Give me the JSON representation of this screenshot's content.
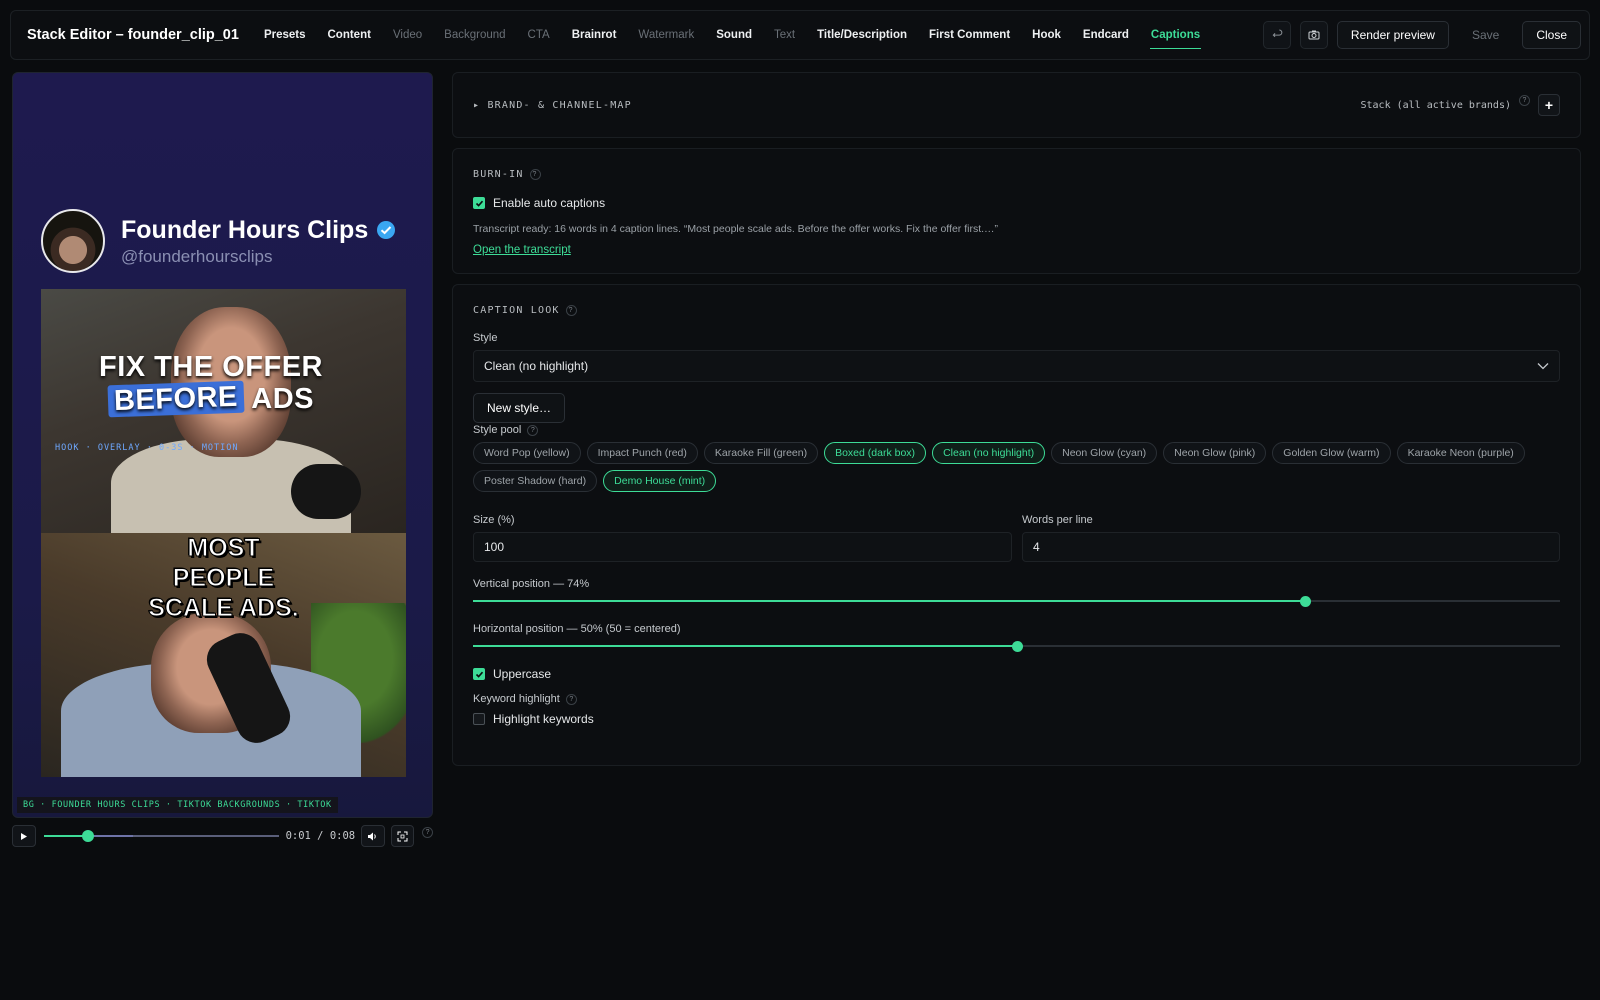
{
  "header": {
    "title": "Stack Editor – founder_clip_01",
    "tabs": [
      {
        "label": "Presets",
        "state": "normal"
      },
      {
        "label": "Content",
        "state": "normal"
      },
      {
        "label": "Video",
        "state": "dim"
      },
      {
        "label": "Background",
        "state": "dim"
      },
      {
        "label": "CTA",
        "state": "dim"
      },
      {
        "label": "Brainrot",
        "state": "normal"
      },
      {
        "label": "Watermark",
        "state": "dim"
      },
      {
        "label": "Sound",
        "state": "normal"
      },
      {
        "label": "Text",
        "state": "dim"
      },
      {
        "label": "Title/Description",
        "state": "normal"
      },
      {
        "label": "First Comment",
        "state": "normal"
      },
      {
        "label": "Hook",
        "state": "normal"
      },
      {
        "label": "Endcard",
        "state": "normal"
      },
      {
        "label": "Captions",
        "state": "active"
      }
    ],
    "render_label": "Render preview",
    "save_label": "Save",
    "close_label": "Close"
  },
  "preview": {
    "channel_name": "Founder Hours Clips",
    "channel_handle": "@founderhoursclips",
    "hook_line1": "FIX THE OFFER",
    "hook_highlight": "BEFORE",
    "hook_line2_rest": " ADS",
    "overlay_label": "HOOK · OVERLAY · 0-3S · MOTION",
    "caption_lines": [
      "MOST",
      "PEOPLE",
      "SCALE ADS."
    ],
    "bg_label": "BG · FOUNDER HOURS CLIPS · TIKTOK BACKGROUNDS · TIKTOK"
  },
  "player": {
    "time": "0:01  /  0:08",
    "progress": 0.19,
    "buffered": 0.38
  },
  "brand": {
    "label": "▸ BRAND- & CHANNEL-MAP",
    "stack_label": "Stack (all active brands)",
    "plus": "+"
  },
  "burnin": {
    "label": "BURN-IN",
    "enable_label": "Enable auto captions",
    "enabled": true,
    "transcript": "Transcript ready: 16 words in 4 caption lines. “Most people scale ads. Before the offer works. Fix the offer first.…”",
    "open_link": "Open the transcript"
  },
  "look": {
    "label": "CAPTION LOOK",
    "style_label": "Style",
    "style_value": "Clean (no highlight)",
    "new_style": "New style…",
    "pool_label": "Style pool",
    "pool": [
      {
        "label": "Word Pop (yellow)",
        "selected": false
      },
      {
        "label": "Impact Punch (red)",
        "selected": false
      },
      {
        "label": "Karaoke Fill (green)",
        "selected": false
      },
      {
        "label": "Boxed (dark box)",
        "selected": true
      },
      {
        "label": "Clean (no highlight)",
        "selected": true
      },
      {
        "label": "Neon Glow (cyan)",
        "selected": false
      },
      {
        "label": "Neon Glow (pink)",
        "selected": false
      },
      {
        "label": "Golden Glow (warm)",
        "selected": false
      },
      {
        "label": "Karaoke Neon (purple)",
        "selected": false
      },
      {
        "label": "Poster Shadow (hard)",
        "selected": false
      },
      {
        "label": "Demo House (mint)",
        "selected": true
      }
    ],
    "size_label": "Size (%)",
    "size_value": "100",
    "wpl_label": "Words per line",
    "wpl_value": "4",
    "vpos_label": "Vertical position — 74%",
    "vpos_value": 0.765,
    "hpos_label": "Horizontal position — 50% (50 = centered)",
    "hpos_value": 0.5,
    "uppercase_label": "Uppercase",
    "uppercase": true,
    "kw_label": "Keyword highlight",
    "kw_check_label": "Highlight keywords",
    "kw_enabled": false
  },
  "help": "?"
}
